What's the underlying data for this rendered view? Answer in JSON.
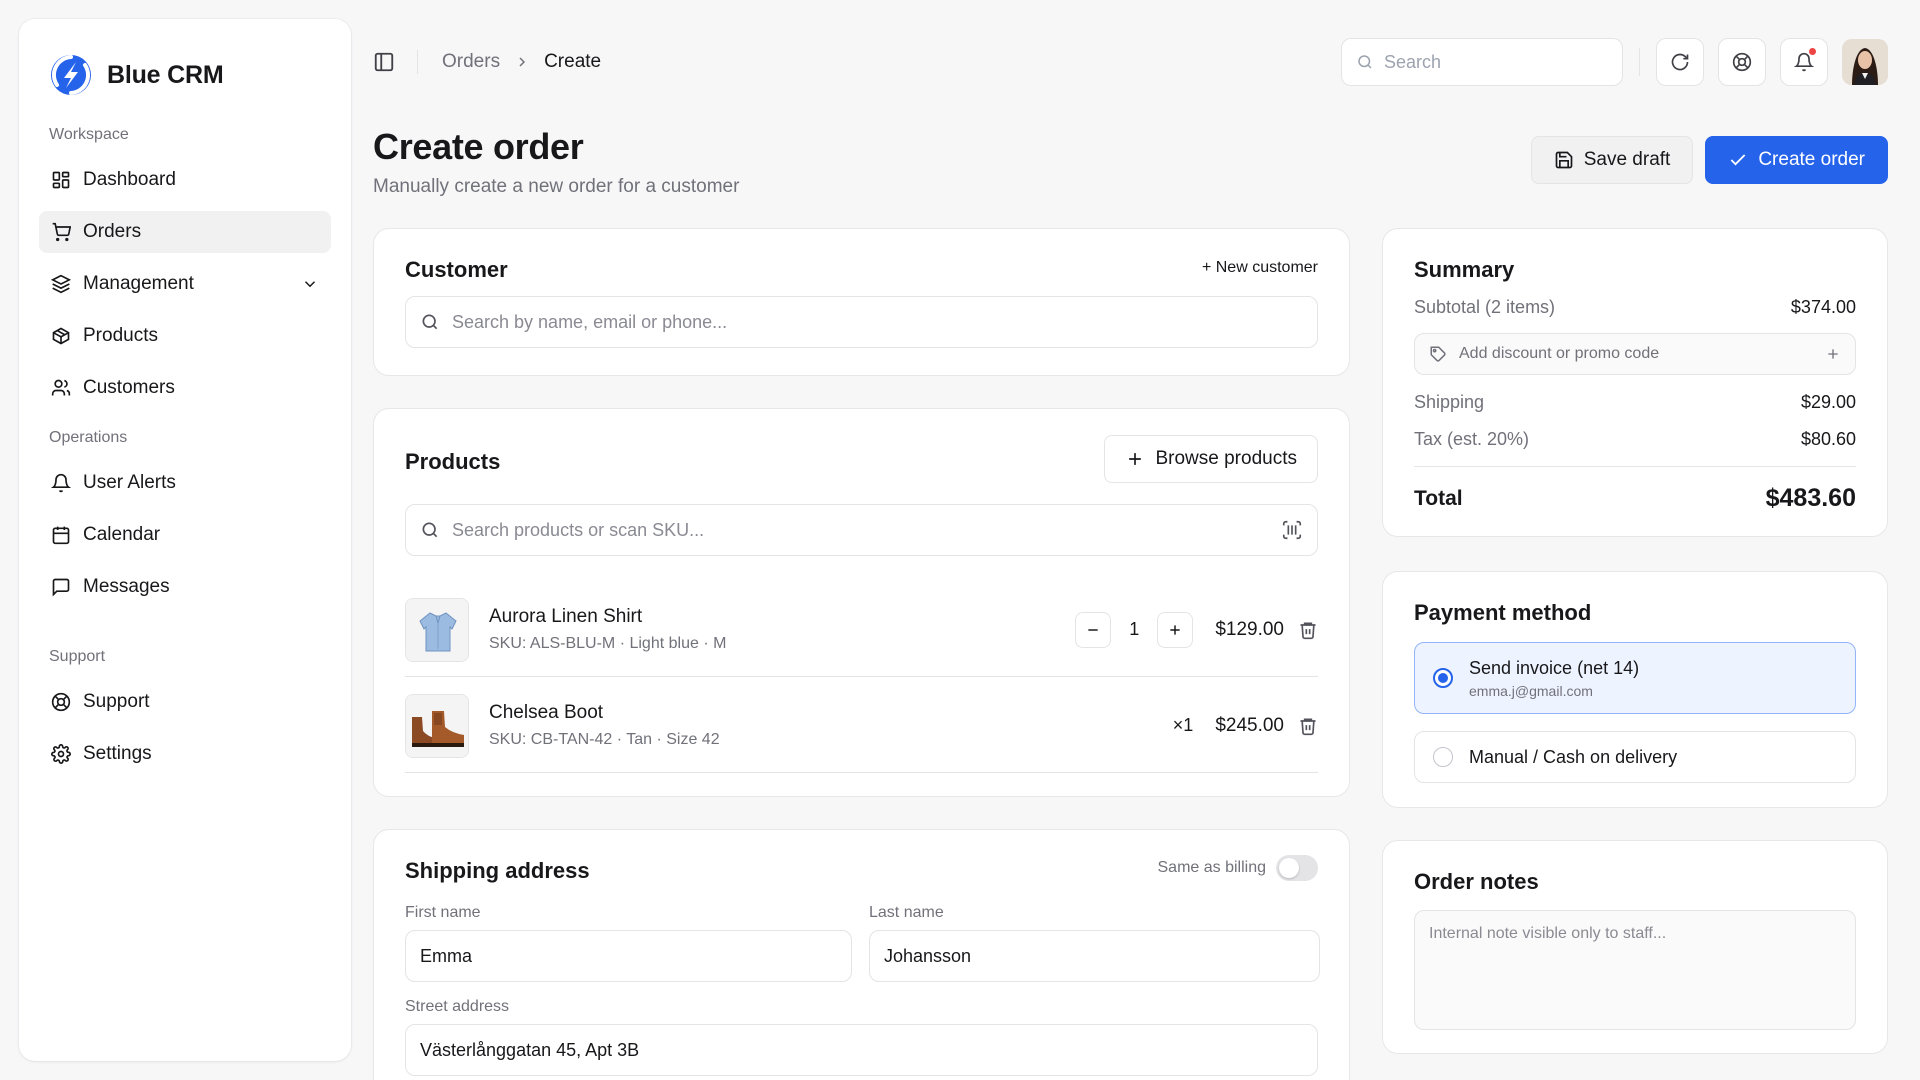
{
  "app": {
    "name": "Blue CRM"
  },
  "sidebar": {
    "workspace_label": "Workspace",
    "workspace_items": [
      {
        "label": "Dashboard",
        "icon": "dashboard-icon"
      },
      {
        "label": "Orders",
        "icon": "cart-icon",
        "active": true
      },
      {
        "label": "Management",
        "icon": "layers-icon",
        "expandable": true
      },
      {
        "label": "Products",
        "icon": "box-icon"
      },
      {
        "label": "Customers",
        "icon": "users-icon"
      }
    ],
    "operations_label": "Operations",
    "operations_items": [
      {
        "label": "User Alerts",
        "icon": "bell-icon"
      },
      {
        "label": "Calendar",
        "icon": "calendar-icon"
      },
      {
        "label": "Messages",
        "icon": "message-icon"
      }
    ],
    "support_label": "Support",
    "support_items": [
      {
        "label": "Support",
        "icon": "lifebuoy-icon"
      },
      {
        "label": "Settings",
        "icon": "gear-icon"
      }
    ]
  },
  "topbar": {
    "breadcrumb": [
      "Orders",
      "Create"
    ],
    "search_placeholder": "Search"
  },
  "page": {
    "title": "Create order",
    "subtitle": "Manually create a new order for a customer",
    "save_draft_label": "Save draft",
    "create_order_label": "Create order"
  },
  "customer": {
    "title": "Customer",
    "new_customer_label": "+ New customer",
    "search_placeholder": "Search by name, email or phone..."
  },
  "products": {
    "title": "Products",
    "browse_label": "Browse products",
    "search_placeholder": "Search products or scan SKU...",
    "items": [
      {
        "name": "Aurora Linen Shirt",
        "sku": "SKU: ALS-BLU-M · Light blue · M",
        "qty": "1",
        "price": "$129.00"
      },
      {
        "name": "Chelsea Boot",
        "sku": "SKU: CB-TAN-42 · Tan · Size 42",
        "qty_label": "×1",
        "price": "$245.00"
      }
    ]
  },
  "shipping": {
    "title": "Shipping address",
    "same_as_billing_label": "Same as billing",
    "same_as_billing": false,
    "first_name_label": "First name",
    "first_name": "Emma",
    "last_name_label": "Last name",
    "last_name": "Johansson",
    "street_label": "Street address",
    "street": "Västerlånggatan 45, Apt 3B"
  },
  "summary": {
    "title": "Summary",
    "subtotal_label": "Subtotal (2 items)",
    "subtotal": "$374.00",
    "discount_placeholder": "Add discount or promo code",
    "shipping_label": "Shipping",
    "shipping": "$29.00",
    "tax_label": "Tax (est. 20%)",
    "tax": "$80.60",
    "total_label": "Total",
    "total": "$483.60"
  },
  "payment": {
    "title": "Payment method",
    "options": [
      {
        "title": "Send invoice (net 14)",
        "sub": "emma.j@gmail.com",
        "selected": true
      },
      {
        "title": "Manual / Cash on delivery",
        "selected": false
      }
    ]
  },
  "notes": {
    "title": "Order notes",
    "placeholder": "Internal note visible only to staff..."
  },
  "colors": {
    "accent": "#2563eb",
    "notification": "#ef4444"
  }
}
